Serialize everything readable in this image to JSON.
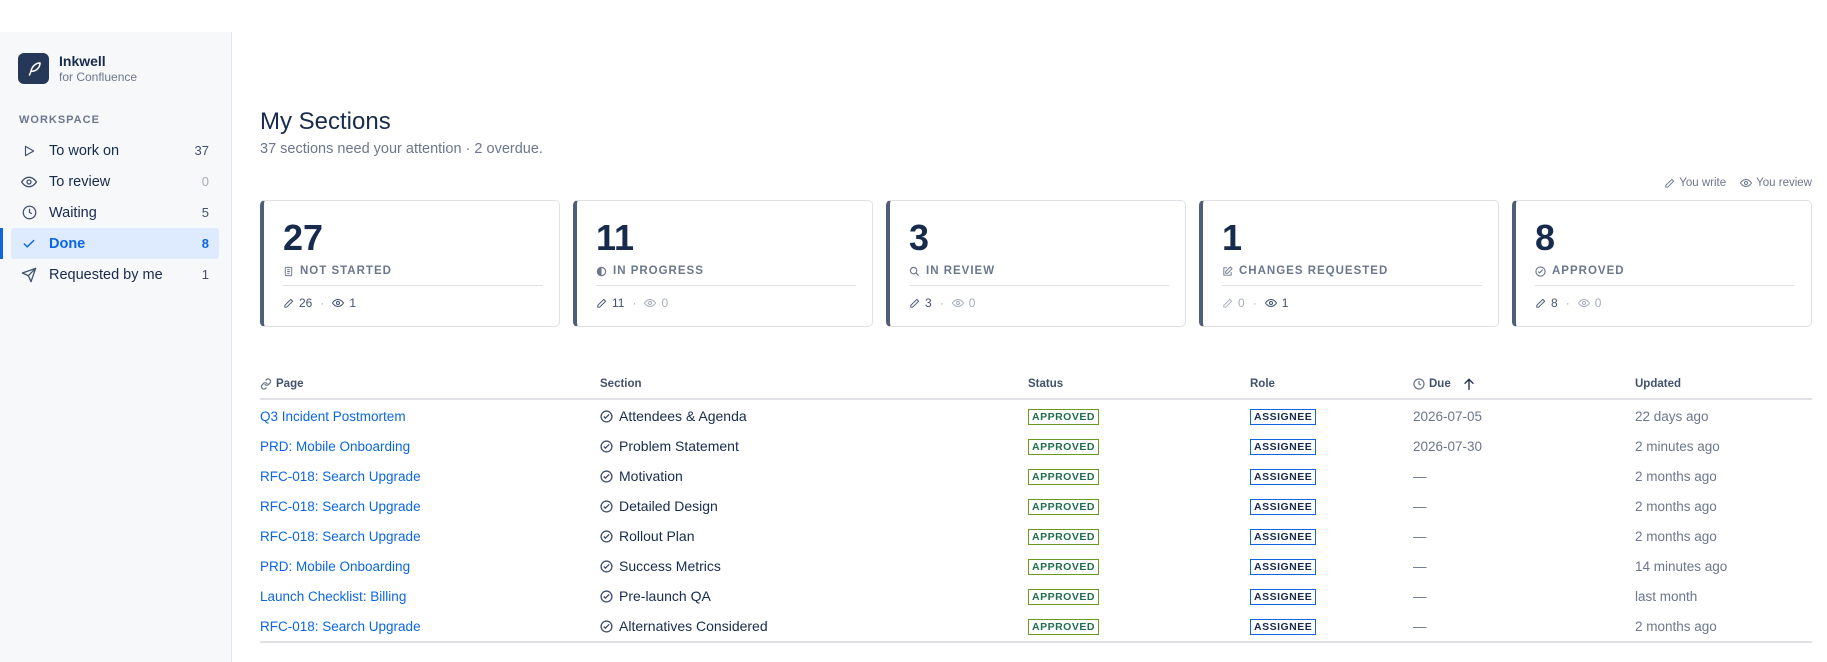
{
  "brand": {
    "name": "Inkwell",
    "subtitle": "for Confluence"
  },
  "sidebar": {
    "section_label": "WORKSPACE",
    "items": [
      {
        "label": "To work on",
        "count": "37",
        "icon": "play-icon",
        "active": false
      },
      {
        "label": "To review",
        "count": "0",
        "icon": "eye-icon",
        "active": false
      },
      {
        "label": "Waiting",
        "count": "5",
        "icon": "clock-icon",
        "active": false
      },
      {
        "label": "Done",
        "count": "8",
        "icon": "check-icon",
        "active": true
      },
      {
        "label": "Requested by me",
        "count": "1",
        "icon": "send-icon",
        "active": false
      }
    ]
  },
  "header": {
    "title": "My Sections",
    "subtitle": "37 sections need your attention · 2 overdue."
  },
  "legend": {
    "write": "You write",
    "review": "You review"
  },
  "cards": [
    {
      "value": "27",
      "label": "NOT STARTED",
      "icon": "document-icon",
      "write": "26",
      "review": "1"
    },
    {
      "value": "11",
      "label": "IN PROGRESS",
      "icon": "half-circle-icon",
      "write": "11",
      "review": "0"
    },
    {
      "value": "3",
      "label": "IN REVIEW",
      "icon": "search-icon",
      "write": "3",
      "review": "0"
    },
    {
      "value": "1",
      "label": "CHANGES REQUESTED",
      "icon": "edit-box-icon",
      "write": "0",
      "review": "1"
    },
    {
      "value": "8",
      "label": "APPROVED",
      "icon": "check-circle-icon",
      "write": "8",
      "review": "0"
    }
  ],
  "table": {
    "columns": {
      "page": "Page",
      "section": "Section",
      "status": "Status",
      "role": "Role",
      "due": "Due",
      "updated": "Updated"
    },
    "rows": [
      {
        "page": "Q3 Incident Postmortem",
        "section": "Attendees & Agenda",
        "status": "APPROVED",
        "role": "ASSIGNEE",
        "due": "2026-07-05",
        "updated": "22 days ago"
      },
      {
        "page": "PRD: Mobile Onboarding",
        "section": "Problem Statement",
        "status": "APPROVED",
        "role": "ASSIGNEE",
        "due": "2026-07-30",
        "updated": "2 minutes ago"
      },
      {
        "page": "RFC-018: Search Upgrade",
        "section": "Motivation",
        "status": "APPROVED",
        "role": "ASSIGNEE",
        "due": "—",
        "updated": "2 months ago"
      },
      {
        "page": "RFC-018: Search Upgrade",
        "section": "Detailed Design",
        "status": "APPROVED",
        "role": "ASSIGNEE",
        "due": "—",
        "updated": "2 months ago"
      },
      {
        "page": "RFC-018: Search Upgrade",
        "section": "Rollout Plan",
        "status": "APPROVED",
        "role": "ASSIGNEE",
        "due": "—",
        "updated": "2 months ago"
      },
      {
        "page": "PRD: Mobile Onboarding",
        "section": "Success Metrics",
        "status": "APPROVED",
        "role": "ASSIGNEE",
        "due": "—",
        "updated": "14 minutes ago"
      },
      {
        "page": "Launch Checklist: Billing",
        "section": "Pre-launch QA",
        "status": "APPROVED",
        "role": "ASSIGNEE",
        "due": "—",
        "updated": "last month"
      },
      {
        "page": "RFC-018: Search Upgrade",
        "section": "Alternatives Considered",
        "status": "APPROVED",
        "role": "ASSIGNEE",
        "due": "—",
        "updated": "2 months ago"
      }
    ]
  },
  "colors": {
    "accent": "#0c66e4",
    "card_border": "#505f79",
    "approved": "#216e4e",
    "sidebar_bg": "#f7f8f9",
    "active_bg": "#deebff"
  }
}
